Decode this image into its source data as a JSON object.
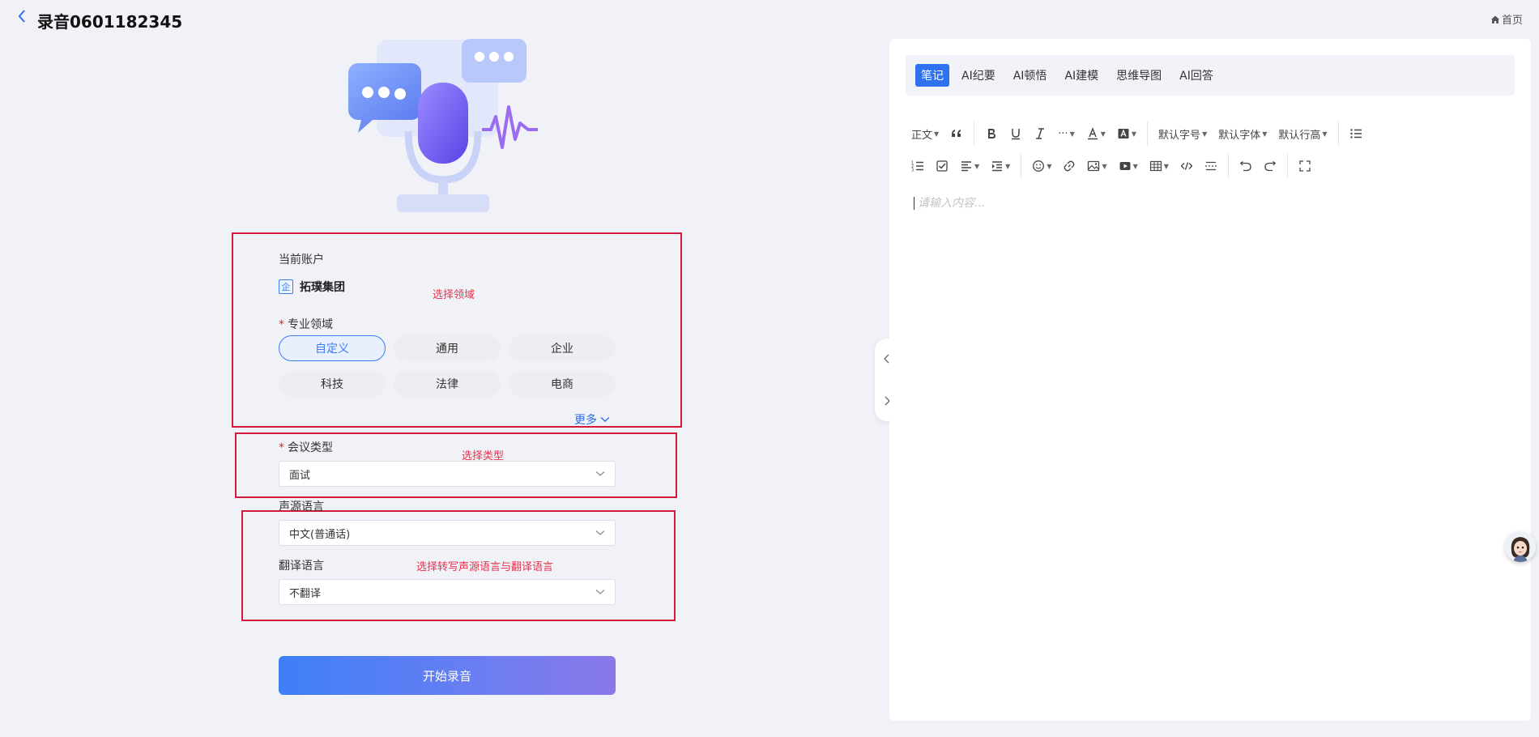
{
  "header": {
    "title": "录音0601182345",
    "home_label": "首页"
  },
  "form": {
    "account_label": "当前账户",
    "account_icon_text": "企",
    "account_name": "拓璞集团",
    "domain_label": "专业领域",
    "domains": [
      "自定义",
      "通用",
      "企业",
      "科技",
      "法律",
      "电商"
    ],
    "selected_domain": "自定义",
    "more_label": "更多",
    "meeting_type_label": "会议类型",
    "meeting_type_value": "面试",
    "source_lang_label": "声源语言",
    "source_lang_value": "中文(普通话)",
    "translate_lang_label": "翻译语言",
    "translate_lang_value": "不翻译",
    "start_button": "开始录音"
  },
  "annotations": {
    "domain": "选择领域",
    "type": "选择类型",
    "lang": "选择转写声源语言与翻译语言"
  },
  "editor": {
    "tabs": [
      "笔记",
      "AI纪要",
      "AI顿悟",
      "AI建模",
      "思维导图",
      "AI回答"
    ],
    "active_tab": "笔记",
    "toolbar": {
      "paragraph": "正文",
      "font_size": "默认字号",
      "font_family": "默认字体",
      "line_height": "默认行高",
      "more": "···"
    },
    "placeholder": "请输入内容..."
  },
  "colors": {
    "primary": "#2f72f0",
    "annotation": "#d7193c",
    "background": "#f0f2f8"
  }
}
